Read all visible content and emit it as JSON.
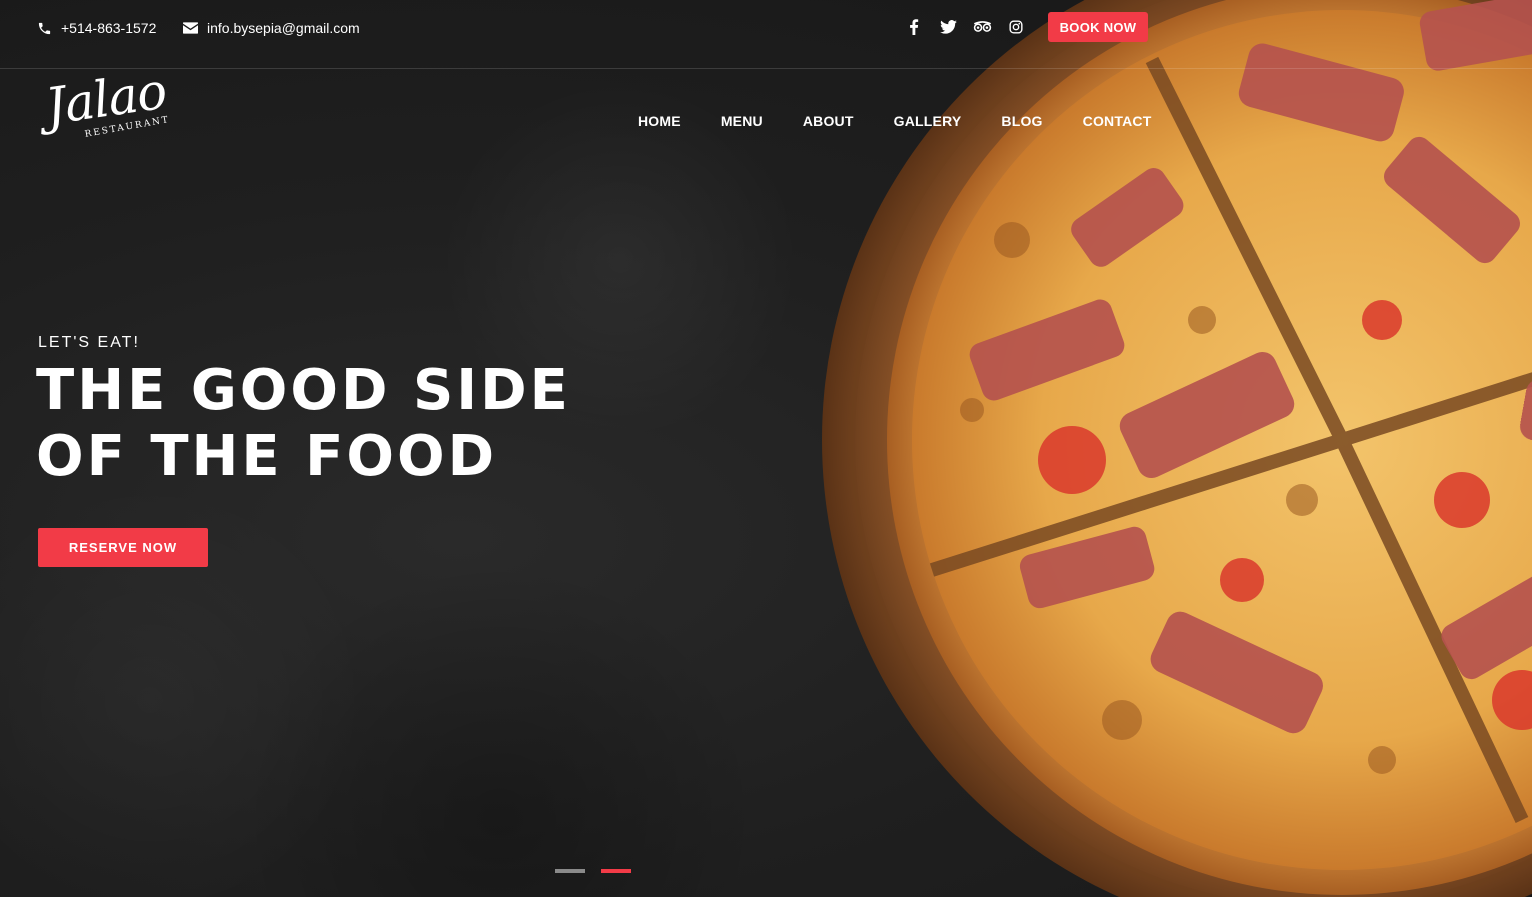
{
  "topbar": {
    "phone": "+514-863-1572",
    "email": "info.bysepia@gmail.com",
    "socials": [
      {
        "name": "facebook-icon"
      },
      {
        "name": "twitter-icon"
      },
      {
        "name": "tripadvisor-icon"
      },
      {
        "name": "instagram-icon"
      }
    ],
    "book_label": "BOOK NOW"
  },
  "logo": {
    "script": "Jalao",
    "sub": "RESTAURANT"
  },
  "nav": {
    "items": [
      "HOME",
      "MENU",
      "ABOUT",
      "GALLERY",
      "BLOG",
      "CONTACT"
    ]
  },
  "hero": {
    "eyebrow": "LET'S EAT!",
    "line1": "THE GOOD SIDE",
    "line2": "OF THE FOOD",
    "cta": "RESERVE NOW"
  },
  "slider": {
    "slides": 2,
    "active": 2
  },
  "colors": {
    "accent": "#f23b47",
    "background": "#1e1e1e"
  }
}
